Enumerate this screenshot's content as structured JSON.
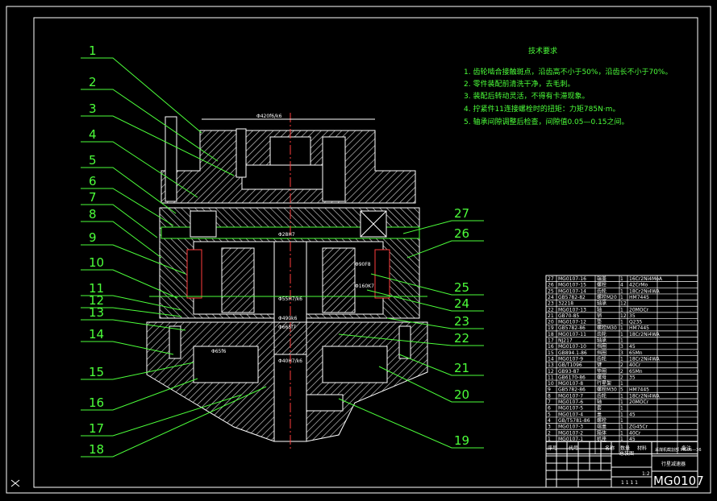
{
  "drawing": {
    "code": "MG0107",
    "scale": "1:2",
    "sheet_marks": "1 1 1 1"
  },
  "notes": {
    "title": "技术要求",
    "items": [
      "1. 齿轮啮合接触斑点，沿齿高不小于50%，沿齿长不小于70%。",
      "2. 零件装配前清洗干净，去毛刺。",
      "3. 装配后转动灵活，不得有卡滞现象。",
      "4. 拧紧件11连接螺栓时的扭矩：力矩785N·m。",
      "5. 轴承间隙调整后检查，间隙值0.05—0.15之间。"
    ]
  },
  "dimensions": [
    "Φ420f6/k6",
    "Φ28H7",
    "Φ90F8",
    "Φ160K7",
    "Φ55H7/k6",
    "Φ490k6",
    "Φ665f7",
    "Φ65f6",
    "Φ40H7/k6"
  ],
  "left_labels": [
    "1",
    "2",
    "3",
    "4",
    "5",
    "6",
    "7",
    "8",
    "9",
    "10",
    "11",
    "12",
    "13",
    "14",
    "15",
    "16",
    "17",
    "18"
  ],
  "right_labels": [
    "27",
    "26",
    "25",
    "24",
    "23",
    "22",
    "21",
    "20",
    "19"
  ],
  "bom": {
    "rows": [
      [
        "27",
        "MG0107-16",
        "端盖",
        "1",
        "16Cr2Ni4MoA"
      ],
      [
        "26",
        "MG0107-15",
        "螺栓",
        "4",
        "42CrMo"
      ],
      [
        "25",
        "MG0107-14",
        "齿轮",
        "1",
        "18Cr2Ni4WA"
      ],
      [
        "24",
        "GB5782-82",
        "螺栓M20",
        "1",
        "HM7445"
      ],
      [
        "23",
        "32218",
        "轴承",
        "12",
        ""
      ],
      [
        "22",
        "MG0107-13",
        "轴",
        "1",
        "20MOCr"
      ],
      [
        "21",
        "GB70-85",
        "销",
        "12",
        "35"
      ],
      [
        "20",
        "MG0107-12",
        "垫",
        "1",
        "Q235"
      ],
      [
        "19",
        "GB5782-86",
        "螺栓M30",
        "1",
        "HM7445"
      ],
      [
        "18",
        "MG0107-11",
        "齿轮",
        "1",
        "18Cr2Ni4WA"
      ],
      [
        "17",
        "NJ217",
        "轴承",
        "1",
        ""
      ],
      [
        "16",
        "MG0107-10",
        "挡圈",
        "3",
        "45"
      ],
      [
        "15",
        "GB894.1-86",
        "挡圈",
        "3",
        "65Mn"
      ],
      [
        "14",
        "MG0107-9",
        "齿轮",
        "1",
        "18Cr2Ni4WA"
      ],
      [
        "13",
        "GB/T1096",
        "键",
        "2",
        "40Cr"
      ],
      [
        "12",
        "GB93-87",
        "垫圈",
        "2",
        "65Mn"
      ],
      [
        "11",
        "GB6170-86",
        "螺母",
        "2",
        "35"
      ],
      [
        "10",
        "MG0107-8",
        "行星架",
        "1",
        ""
      ],
      [
        "9",
        "GB5782-86",
        "螺栓M30",
        "5",
        "HM7445"
      ],
      [
        "8",
        "MG0107-7",
        "齿轮",
        "1",
        "18Cr2Ni4WA"
      ],
      [
        "7",
        "MG0107-6",
        "轴",
        "1",
        "20MOCr"
      ],
      [
        "6",
        "MG0107-5",
        "套",
        "1",
        ""
      ],
      [
        "5",
        "MG0107-4",
        "盖",
        "1",
        "45"
      ],
      [
        "4",
        "GB/T5781-86",
        "螺栓",
        "1",
        ""
      ],
      [
        "3",
        "MG0107-3",
        "端盖",
        "1",
        "ZG45Cr"
      ],
      [
        "2",
        "MG0107-2",
        "箱体",
        "1",
        "40Cr"
      ],
      [
        "1",
        "MG0107-1",
        "机座",
        "1",
        "45"
      ]
    ],
    "header": [
      "序号",
      "代号",
      "名称",
      "数量",
      "材料",
      "备注"
    ],
    "title_left": "总装图",
    "title_right_top": "采煤机截割部 MG05—36",
    "title_right_mid": "行星减速器"
  }
}
